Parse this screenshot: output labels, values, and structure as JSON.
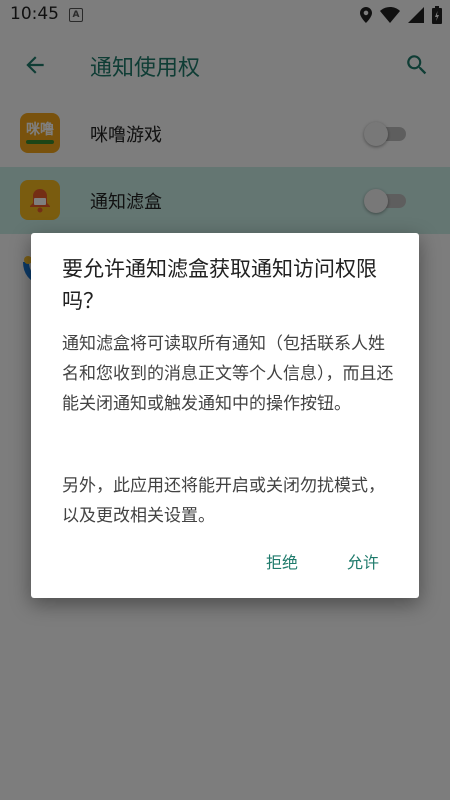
{
  "status": {
    "time": "10:45",
    "notif_letter": "A"
  },
  "appbar": {
    "title": "通知使用权"
  },
  "list": [
    {
      "label": "咪噜游戏",
      "icon_text": "咪噜",
      "enabled": false
    },
    {
      "label": "通知滤盒",
      "enabled": false
    }
  ],
  "dialog": {
    "title": "要允许通知滤盒获取通知访问权限吗？",
    "body1": "通知滤盒将可读取所有通知（包括联系人姓名和您收到的消息正文等个人信息），而且还能关闭通知或触发通知中的操作按钮。",
    "body2": "另外，此应用还将能开启或关闭勿扰模式，以及更改相关设置。",
    "deny": "拒绝",
    "allow": "允许"
  },
  "colors": {
    "accent": "#1e7a6b",
    "selected_row": "#c9ece5"
  }
}
